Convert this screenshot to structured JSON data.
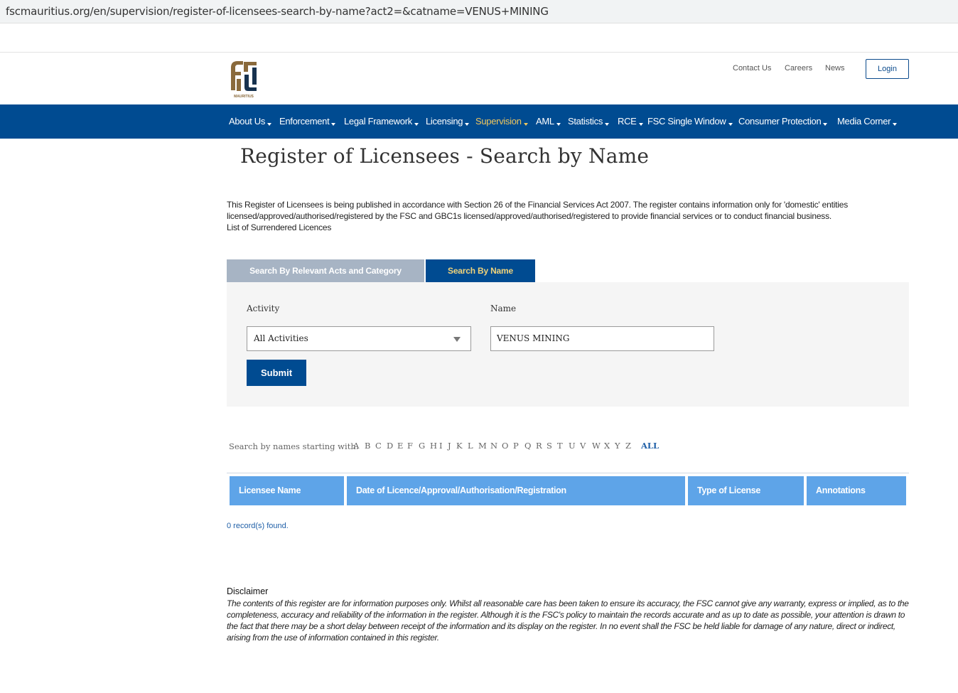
{
  "browser": {
    "url": "fscmauritius.org/en/supervision/register-of-licensees-search-by-name?act2=&catname=VENUS+MINING"
  },
  "header": {
    "logo_text": "MAURITIUS",
    "top_links": [
      "Contact Us",
      "Careers",
      "News"
    ],
    "login_label": "Login"
  },
  "nav": {
    "items": [
      {
        "label": "About Us"
      },
      {
        "label": "Enforcement"
      },
      {
        "label": "Legal Framework"
      },
      {
        "label": "Licensing"
      },
      {
        "label": "Supervision"
      },
      {
        "label": "AML"
      },
      {
        "label": "Statistics"
      },
      {
        "label": "RCE"
      },
      {
        "label": "FSC Single Window"
      },
      {
        "label": "Consumer Protection"
      },
      {
        "label": "Media Corner"
      }
    ],
    "active": "Supervision"
  },
  "page": {
    "title": "Register of Licensees - Search by Name",
    "intro_line1": "This Register of Licensees is being published in accordance with Section 26 of the Financial Services Act 2007. The register contains information only for 'domestic' entities licensed/approved/authorised/registered by the FSC and GBC1s licensed/approved/authorised/registered to provide financial services or to conduct financial business.",
    "intro_line2": "List of Surrendered Licences"
  },
  "tabs": {
    "acts_label": "Search By Relevant Acts and Category",
    "name_label": "Search By Name"
  },
  "search": {
    "activity_label": "Activity",
    "activity_value": "All Activities",
    "name_label": "Name",
    "name_value": "VENUS MINING",
    "submit_label": "Submit"
  },
  "alphabet": {
    "label": "Search by names starting with:",
    "letters": [
      "A",
      "B",
      "C",
      "D",
      "E",
      "F",
      "G",
      "H",
      "I",
      "J",
      "K",
      "L",
      "M",
      "N",
      "O",
      "P",
      "Q",
      "R",
      "S",
      "T",
      "U",
      "V",
      "W",
      "X",
      "Y",
      "Z"
    ],
    "all_label": "ALL"
  },
  "table": {
    "columns": [
      "Licensee Name",
      "Date of Licence/Approval/Authorisation/Registration",
      "Type of License",
      "Annotations"
    ],
    "records_text": "0 record(s) found."
  },
  "disclaimer": {
    "title": "Disclaimer",
    "text": "The contents of this register are for information purposes only. Whilst all reasonable care has been taken to ensure its accuracy, the FSC cannot give any warranty, express or implied, as to the completeness, accuracy and reliability of the information in the register. Although it is the FSC's policy to maintain the records accurate and as up to date as possible, your attention is drawn to the fact that there may be a short delay between receipt of the information and its display on the register. In no event shall the FSC be held liable for damage of any nature, direct or indirect, arising from the use of information contained in this register."
  },
  "colors": {
    "nav_bg": "#004b91",
    "nav_active": "#f0c75e",
    "table_header": "#5ea4e8",
    "logo_brown": "#8a6a3c"
  }
}
